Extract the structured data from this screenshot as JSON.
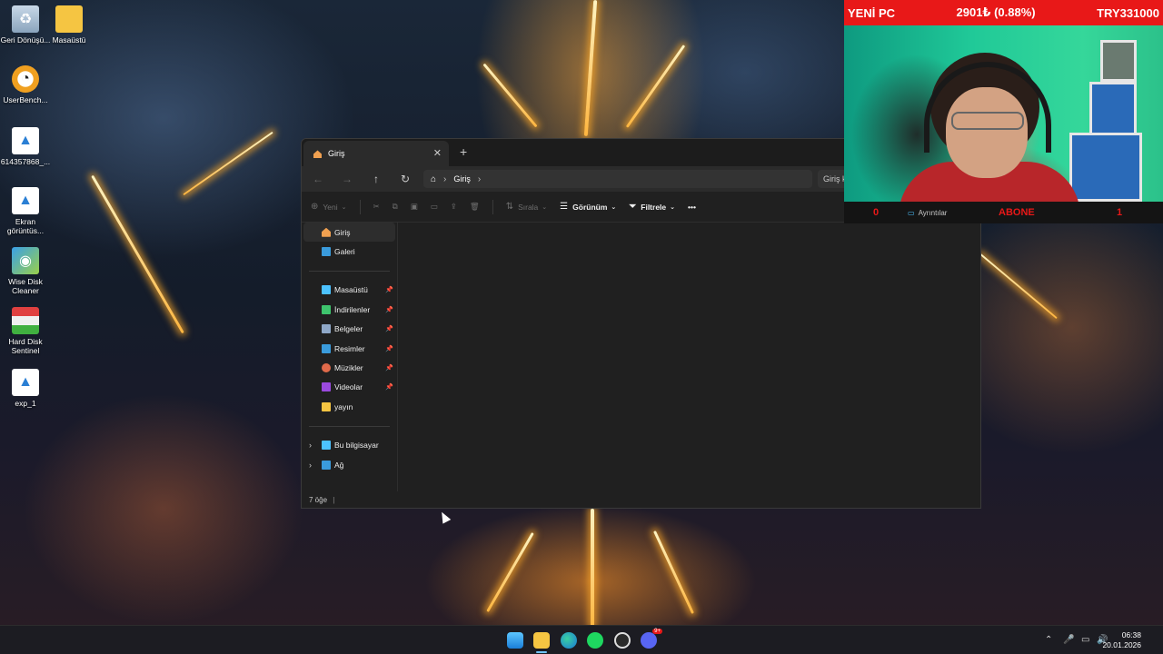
{
  "desktop": {
    "icons": [
      {
        "label": "Geri Dönüşü...",
        "icon": "recycle-bin-icon"
      },
      {
        "label": "Masaüstü",
        "icon": "folder-icon"
      },
      {
        "label": "UserBench...",
        "icon": "userbenchmark-icon"
      },
      {
        "label": "614357868_...",
        "icon": "image-file-icon"
      },
      {
        "label": "Ekran görüntüs...",
        "icon": "image-file-icon"
      },
      {
        "label": "Wise Disk Cleaner",
        "icon": "wise-disk-cleaner-icon"
      },
      {
        "label": "Hard Disk Sentinel",
        "icon": "hard-disk-sentinel-icon"
      },
      {
        "label": "exp_1",
        "icon": "image-file-icon"
      }
    ]
  },
  "explorer": {
    "tab_title": "Giriş",
    "tab_close": "✕",
    "tab_add": "+",
    "breadcrumb": "Giriş",
    "search_placeholder": "Giriş k",
    "commands": {
      "new": "Yeni",
      "sort": "Sırala",
      "view": "Görünüm",
      "filter": "Filtrele",
      "more": "•••"
    },
    "sidebar": {
      "top": [
        {
          "label": "Giriş",
          "icon": "home-icon"
        },
        {
          "label": "Galeri",
          "icon": "gallery-icon"
        }
      ],
      "pinned": [
        {
          "label": "Masaüstü",
          "icon": "desktop-folder-icon",
          "color": "#4cc2ff"
        },
        {
          "label": "İndirilenler",
          "icon": "downloads-icon",
          "color": "#3ec46d"
        },
        {
          "label": "Belgeler",
          "icon": "documents-icon",
          "color": "#8fa8c8"
        },
        {
          "label": "Resimler",
          "icon": "pictures-icon",
          "color": "#3a9bdc"
        },
        {
          "label": "Müzikler",
          "icon": "music-icon",
          "color": "#e06a4a"
        },
        {
          "label": "Videolar",
          "icon": "videos-icon",
          "color": "#9b4adf"
        },
        {
          "label": "yayın",
          "icon": "folder-icon",
          "color": "#f5c542"
        }
      ],
      "bottom": [
        {
          "label": "Bu bilgisayar",
          "icon": "this-pc-icon"
        },
        {
          "label": "Ağ",
          "icon": "network-icon"
        }
      ]
    },
    "status": "7 öğe"
  },
  "stream_overlay": {
    "top_left": "YENİ PC",
    "top_middle": "2901₺ (0.88%)",
    "top_right": "TRY331000",
    "bottom_left": "0",
    "details": "Ayrıntılar",
    "abone": "ABONE",
    "bottom_right": "1"
  },
  "taskbar": {
    "time": "06:38",
    "date": "20.01.2026",
    "apps": [
      "start-icon",
      "file-explorer-icon",
      "edge-icon",
      "spotify-icon",
      "obs-icon",
      "discord-icon"
    ],
    "discord_badge": "9+"
  },
  "colors": {
    "overlay_red": "#e81818",
    "explorer_bg": "#202020",
    "taskbar_bg": "#1c1c22"
  }
}
